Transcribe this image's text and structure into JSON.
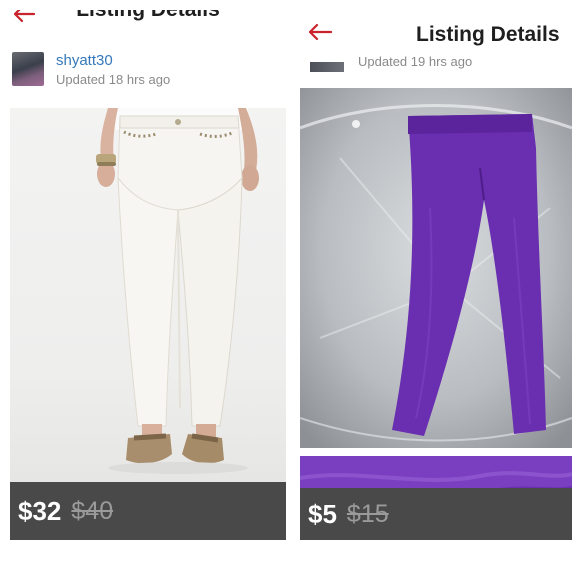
{
  "left_panel": {
    "header_title": "Listing Details",
    "seller": {
      "username": "shyatt30",
      "updated": "Updated 18 hrs ago"
    },
    "price": "$32",
    "original_price": "$40"
  },
  "right_panel": {
    "header_title": "Listing Details",
    "updated": "Updated 19 hrs ago",
    "price": "$5",
    "original_price": "$15"
  },
  "colors": {
    "back_arrow": "#c9232e",
    "username": "#3579ba",
    "price_bar": "#4a4949",
    "leggings": "#6a2fb0"
  },
  "icons": {
    "back": "back-arrow-icon"
  }
}
